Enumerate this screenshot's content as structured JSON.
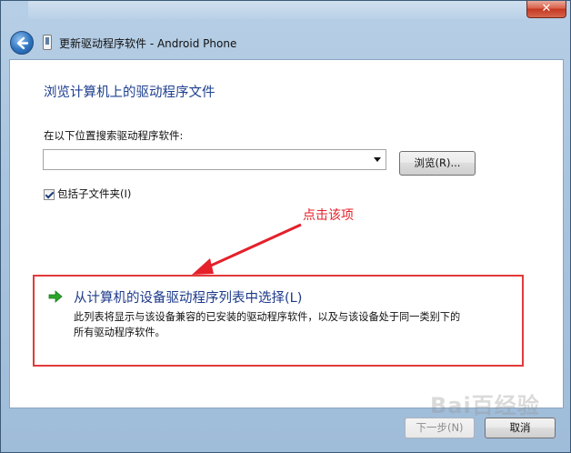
{
  "window": {
    "title": "更新驱动程序软件 - Android Phone",
    "close_label": "✕"
  },
  "content": {
    "heading": "浏览计算机上的驱动程序文件",
    "search_label": "在以下位置搜索驱动程序软件:",
    "path_value": "",
    "browse_label": "浏览(R)...",
    "include_subfolders_label": "包括子文件夹(I)",
    "include_subfolders_checked": true
  },
  "annotation": {
    "text": "点击该项",
    "color": "#e5202a"
  },
  "option": {
    "title": "从计算机的设备驱动程序列表中选择(L)",
    "description_line1": "此列表将显示与该设备兼容的已安装的驱动程序软件，以及与该设备处于同一类别下的",
    "description_line2": "所有驱动程序软件。"
  },
  "footer": {
    "next_label": "下一步(N)",
    "cancel_label": "取消"
  },
  "watermark": {
    "text": "Bai百经验"
  },
  "colors": {
    "heading": "#1e3f8f",
    "link": "#1d3a8a",
    "highlight_box": "#e23a3a"
  },
  "icons": [
    "back-arrow-icon",
    "device-icon",
    "dropdown-arrow-icon",
    "checkbox-icon",
    "green-arrow-icon"
  ]
}
